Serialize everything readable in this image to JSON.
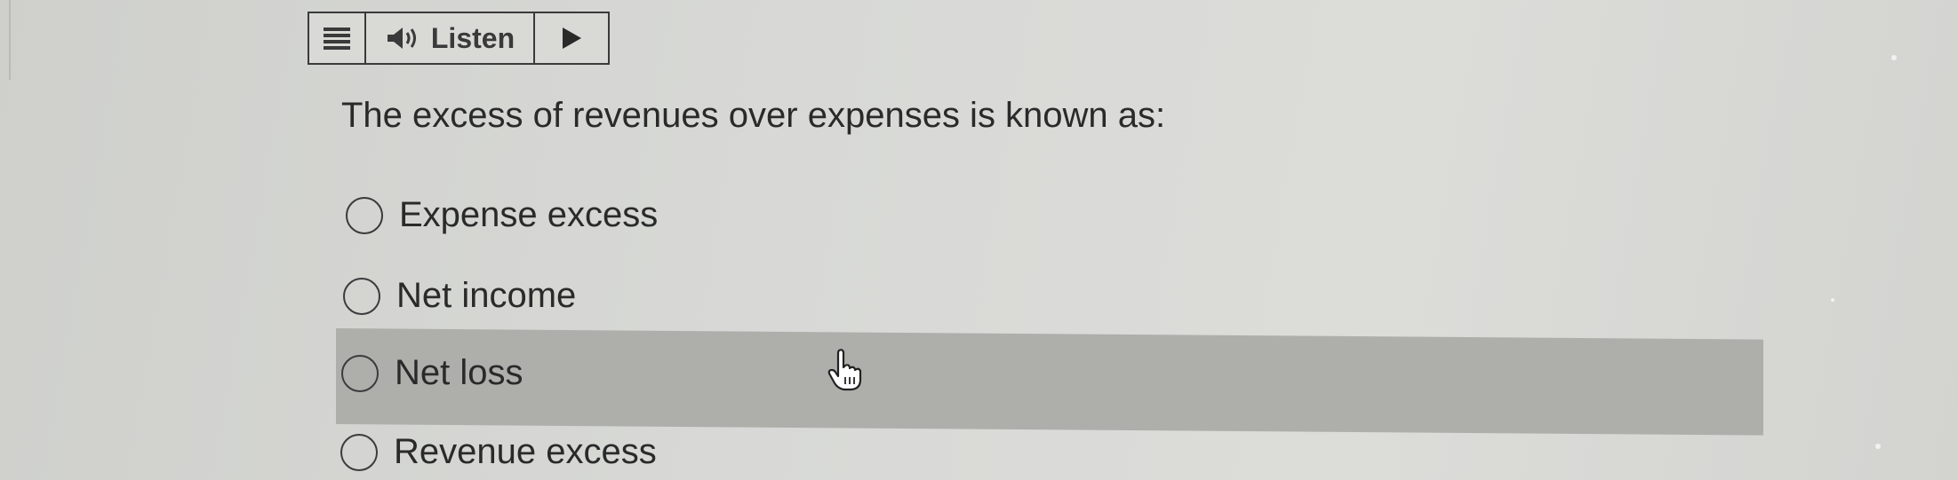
{
  "toolbar": {
    "menu_icon": "hamburger-menu-icon",
    "speaker_icon": "speaker-icon",
    "listen_label": "Listen",
    "play_icon": "play-icon"
  },
  "question": {
    "text": "The excess of revenues over expenses is known as:"
  },
  "options": [
    {
      "label": "Expense excess",
      "selected": false,
      "hovered": false
    },
    {
      "label": "Net income",
      "selected": false,
      "hovered": false
    },
    {
      "label": "Net loss",
      "selected": false,
      "hovered": true
    },
    {
      "label": "Revenue excess",
      "selected": false,
      "hovered": false
    }
  ],
  "colors": {
    "background": "#d8d9d6",
    "hover_highlight": "#aeafab",
    "text": "#2a2a2a",
    "border": "#3a3a3a"
  },
  "cursor": {
    "icon": "hand-pointer-icon"
  }
}
